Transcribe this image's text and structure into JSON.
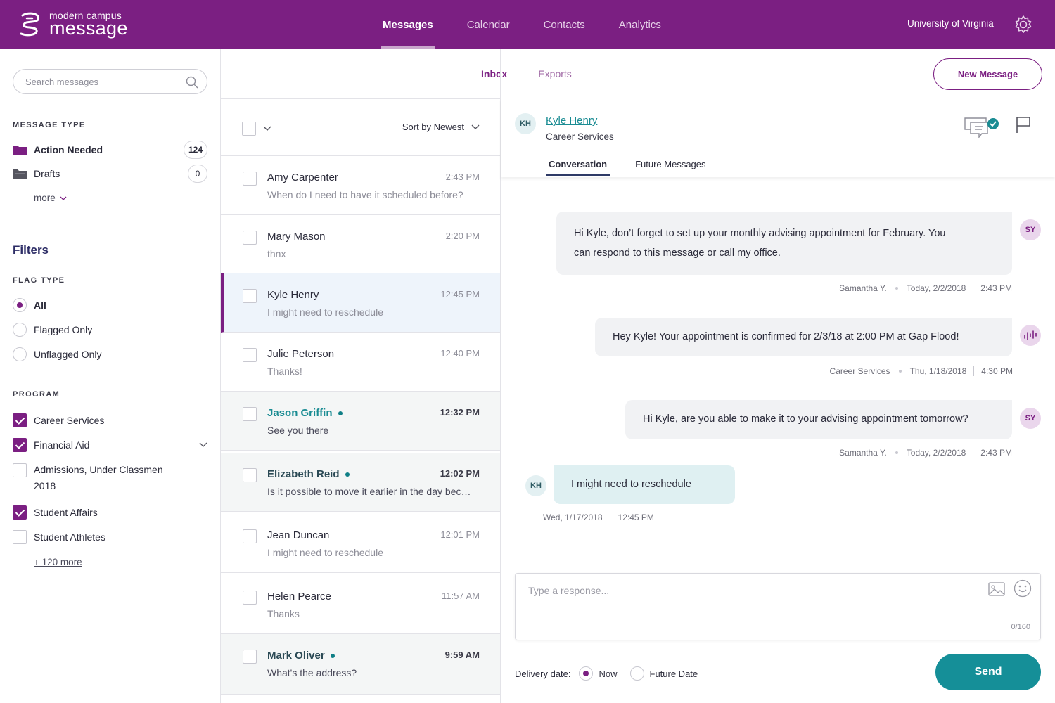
{
  "brand": {
    "small": "modern campus",
    "big": "message"
  },
  "nav": [
    {
      "label": "Messages",
      "active": true
    },
    {
      "label": "Calendar"
    },
    {
      "label": "Contacts"
    },
    {
      "label": "Analytics"
    }
  ],
  "org": "University of Virginia",
  "colors": {
    "primary": "#7b1f82",
    "accent": "#158f98",
    "teal_text": "#1a8c93"
  },
  "sidebar": {
    "search_placeholder": "Search messages",
    "message_type_label": "MESSAGE TYPE",
    "folders": [
      {
        "label": "Action Needed",
        "count": "124",
        "icon": "folder-filled-icon"
      },
      {
        "label": "Drafts",
        "count": "0",
        "icon": "folder-icon"
      }
    ],
    "more_label": "more",
    "filters_title": "Filters",
    "flag_type_label": "FLAG TYPE",
    "flag_options": [
      {
        "label": "All",
        "selected": true
      },
      {
        "label": "Flagged Only"
      },
      {
        "label": "Unflagged Only"
      }
    ],
    "program_label": "PROGRAM",
    "programs": [
      {
        "label": "Career Services",
        "checked": true
      },
      {
        "label": "Financial Aid",
        "checked": true
      },
      {
        "label": "Admissions, Under Classmen",
        "label2": "2018",
        "checked": false
      },
      {
        "label": "Student Affairs",
        "checked": true
      },
      {
        "label": "Student Athletes",
        "checked": false
      }
    ],
    "more_programs": "+ 120 more"
  },
  "top_tabs": [
    {
      "label": "Inbox",
      "active": true
    },
    {
      "label": "Exports"
    }
  ],
  "new_message_label": "New Message",
  "list": {
    "sort_label": "Sort by Newest",
    "rows": [
      {
        "name": "Amy Carpenter",
        "time": "2:43 PM",
        "preview": "When do I need to have it scheduled before?"
      },
      {
        "name": "Mary Mason",
        "time": "2:20 PM",
        "preview": "thnx"
      },
      {
        "name": "Kyle Henry",
        "time": "12:45 PM",
        "preview": "I might need to reschedule"
      },
      {
        "name": "Julie Peterson",
        "time": "12:40 PM",
        "preview": "Thanks!"
      },
      {
        "name": "Jason Griffin",
        "time": "12:32 PM",
        "preview": "See you there"
      },
      {
        "name": "Elizabeth Reid",
        "time": "12:02 PM",
        "preview": "Is it possible to move it earlier in the day because"
      },
      {
        "name": "Jean Duncan",
        "time": "12:01 PM",
        "preview": "I might need to reschedule"
      },
      {
        "name": "Helen Pearce",
        "time": "11:57 AM",
        "preview": "Thanks"
      },
      {
        "name": "Mark Oliver",
        "time": "9:59 AM",
        "preview": "What's the address?"
      }
    ]
  },
  "conversation": {
    "contact_initials": "KH",
    "contact_name": "Kyle Henry",
    "contact_sub": "Career Services",
    "tabs": [
      {
        "label": "Conversation",
        "active": true
      },
      {
        "label": "Future Messages"
      }
    ],
    "messages": [
      {
        "line1": "Hi Kyle, don’t forget to set up your monthly advising appointment for February.  You",
        "line2": "can respond to this message or call my office.",
        "sender": "Samantha Y.",
        "date": "Today, 2/2/2018",
        "time": "2:43 PM",
        "avatar": "SY"
      },
      {
        "line1": "Hey Kyle! Your appointment is confirmed for 2/3/18 at 2:00 PM at Gap Flood!",
        "sender": "Career Services",
        "date": "Thu, 1/18/2018",
        "time": "4:30 PM"
      },
      {
        "line1": "Hi Kyle, are you able to make it to your advising appointment tomorrow?",
        "sender": "Samantha Y.",
        "date": "Today, 2/2/2018",
        "time": "2:43 PM",
        "avatar": "SY"
      },
      {
        "line1": "I might need to reschedule",
        "date": "Wed, 1/17/2018",
        "time": "12:45 PM",
        "avatar": "KH"
      }
    ]
  },
  "compose": {
    "placeholder": "Type a response...",
    "counter": "0/160",
    "delivery_label": "Delivery date:",
    "options": [
      {
        "label": "Now",
        "selected": true
      },
      {
        "label": "Future Date"
      }
    ],
    "send_label": "Send"
  }
}
